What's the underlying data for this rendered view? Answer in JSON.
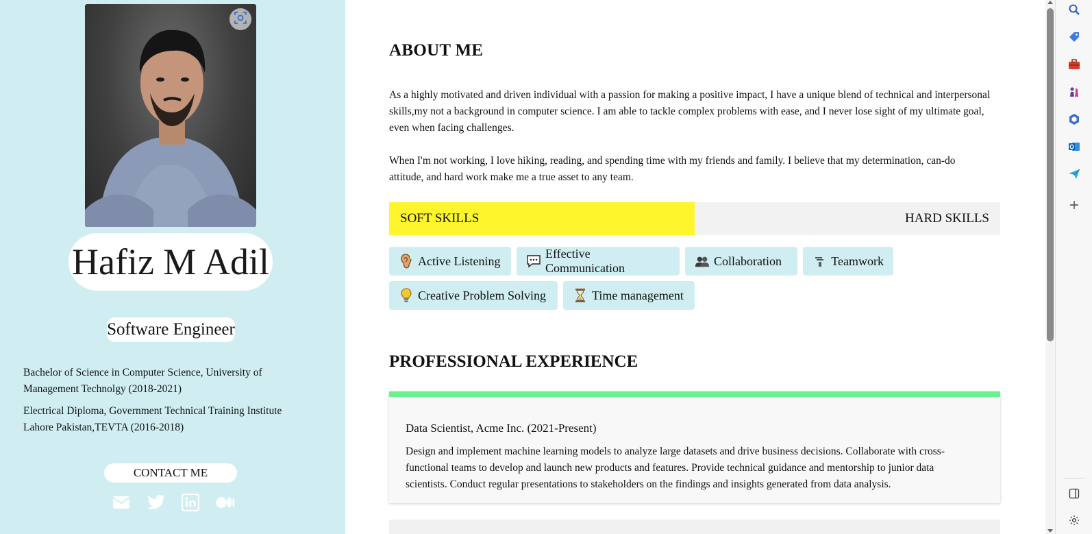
{
  "profile": {
    "name": "Hafiz M Adil",
    "role": "Software Engineer",
    "education": [
      "Bachelor of Science in Computer Science, University of Management Technolgy (2018-2021)",
      "Electrical Diploma, Government Technical Training Institute Lahore Pakistan,TEVTA (2016-2018)"
    ],
    "contact_label": "CONTACT ME",
    "socials": [
      "mail-icon",
      "twitter-icon",
      "linkedin-icon",
      "medium-icon"
    ]
  },
  "about": {
    "heading": "ABOUT ME",
    "paragraphs": [
      "As a highly motivated and driven individual with a passion for making a positive impact, I have a unique blend of technical and interpersonal skills,my not a background in computer science. I am able to tackle complex problems with ease, and I never lose sight of my ultimate goal, even when facing challenges.",
      "When I'm not working, I love hiking, reading, and spending time with my friends and family. I believe that my determination, can-do attitude, and hard work make me a true asset to any team."
    ]
  },
  "skills": {
    "tabs": [
      "SOFT SKILLS",
      "HARD SKILLS"
    ],
    "active_tab": "SOFT SKILLS",
    "soft": [
      {
        "label": "Active Listening",
        "icon": "ear-icon"
      },
      {
        "label": "Effective Communication",
        "icon": "speech-bubble-icon"
      },
      {
        "label": "Collaboration",
        "icon": "people-icon"
      },
      {
        "label": "Teamwork",
        "icon": "teamwork-icon"
      },
      {
        "label": "Creative Problem Solving",
        "icon": "lightbulb-icon"
      },
      {
        "label": "Time management",
        "icon": "hourglass-icon"
      }
    ]
  },
  "experience": {
    "heading": "PROFESSIONAL EXPERIENCE",
    "items": [
      {
        "title": "Data Scientist, Acme Inc. (2021-Present)",
        "description": "Design and implement machine learning models to analyze large datasets and drive business decisions. Collaborate with cross-functional teams to develop and launch new products and features. Provide technical guidance and mentorship to junior data scientists. Conduct regular presentations to stakeholders on the findings and insights generated from data analysis."
      }
    ]
  },
  "colors": {
    "sidebar_bg": "#d0eef1",
    "active_tab": "#fef52d",
    "experience_accent": "#6af08e"
  },
  "browser_sidebar": [
    "search-icon",
    "tag-icon",
    "toolbox-icon",
    "chess-icon",
    "copilot-icon",
    "outlook-icon",
    "send-icon",
    "add-icon",
    "split-screen-icon",
    "settings-icon"
  ]
}
